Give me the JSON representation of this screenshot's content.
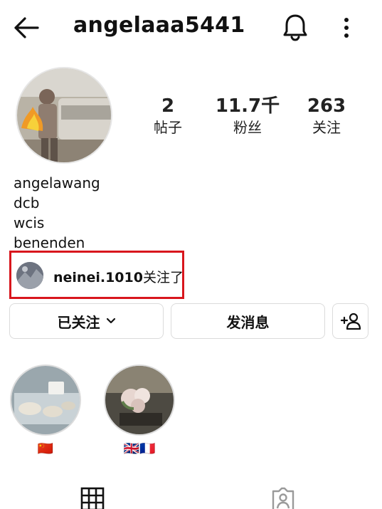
{
  "header": {
    "username": "angelaaa5441",
    "back_icon": "arrow-left-icon",
    "bell_icon": "bell-icon",
    "more_icon": "more-vertical-icon"
  },
  "stats": {
    "posts": {
      "value": "2",
      "label": "帖子"
    },
    "followers": {
      "value": "11.7千",
      "label": "粉丝"
    },
    "following": {
      "value": "263",
      "label": "关注"
    }
  },
  "bio": {
    "name": "angelawang",
    "lines": [
      "dcb",
      "wcis",
      "benenden"
    ]
  },
  "mutual": {
    "name": "neinei.1010",
    "suffix": "关注了",
    "highlight_color": "#d8161d"
  },
  "actions": {
    "following_label": "已关注",
    "message_label": "发消息",
    "add_user_icon": "add-person-icon"
  },
  "highlights": [
    {
      "caption": "🇨🇳"
    },
    {
      "caption": "🇬🇧🇫🇷"
    }
  ],
  "tabs": {
    "grid_icon": "grid-icon",
    "tagged_icon": "tagged-person-icon"
  }
}
